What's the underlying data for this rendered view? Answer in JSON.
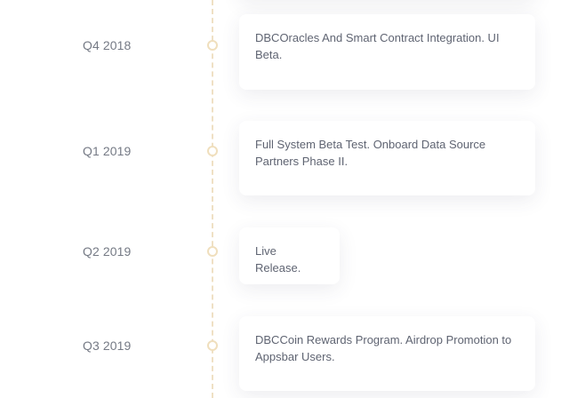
{
  "timeline": {
    "items": [
      {
        "period": "Q4 2018",
        "text": "DBCOracles And Smart Contract Integration. UI Beta."
      },
      {
        "period": "Q1 2019",
        "text": "Full System Beta Test. Onboard Data Source Partners Phase II."
      },
      {
        "period": "Q2 2019",
        "text": "Live Release."
      },
      {
        "period": "Q3 2019",
        "text": "DBCCoin Rewards Program. Airdrop Promotion to Appsbar Users."
      }
    ]
  },
  "colors": {
    "timeline_line": "#efe0c4",
    "dot_border": "#f0dfbd",
    "period_text": "#757a85",
    "card_text": "#5f6472",
    "background": "#ffffff"
  }
}
